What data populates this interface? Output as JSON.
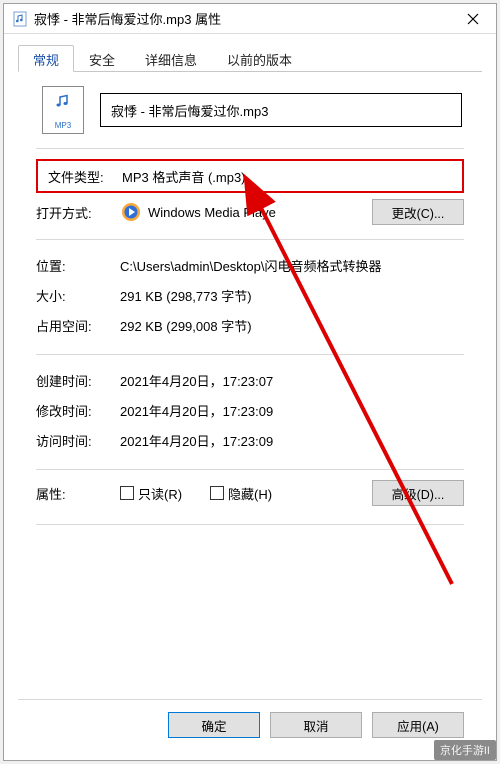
{
  "window": {
    "title": "寂悸 - 非常后悔爱过你.mp3 属性",
    "close": "✕"
  },
  "tabs": {
    "general": "常规",
    "security": "安全",
    "details": "详细信息",
    "previous": "以前的版本"
  },
  "file": {
    "icon_label": "MP3",
    "name": "寂悸 - 非常后悔爱过你.mp3"
  },
  "labels": {
    "filetype": "文件类型:",
    "openwith": "打开方式:",
    "location": "位置:",
    "size": "大小:",
    "diskspace": "占用空间:",
    "created": "创建时间:",
    "modified": "修改时间:",
    "accessed": "访问时间:",
    "attributes": "属性:"
  },
  "values": {
    "filetype": "MP3 格式声音 (.mp3)",
    "openwith": "Windows Media Playe",
    "location": "C:\\Users\\admin\\Desktop\\闪电音频格式转换器",
    "size": "291 KB (298,773 字节)",
    "diskspace": "292 KB (299,008 字节)",
    "created": "2021年4月20日，17:23:07",
    "modified": "2021年4月20日，17:23:09",
    "accessed": "2021年4月20日，17:23:09"
  },
  "buttons": {
    "change": "更改(C)...",
    "advanced": "高级(D)...",
    "ok": "确定",
    "cancel": "取消",
    "apply": "应用(A)"
  },
  "checkboxes": {
    "readonly": "只读(R)",
    "hidden": "隐藏(H)"
  },
  "watermark": "京化手游II"
}
